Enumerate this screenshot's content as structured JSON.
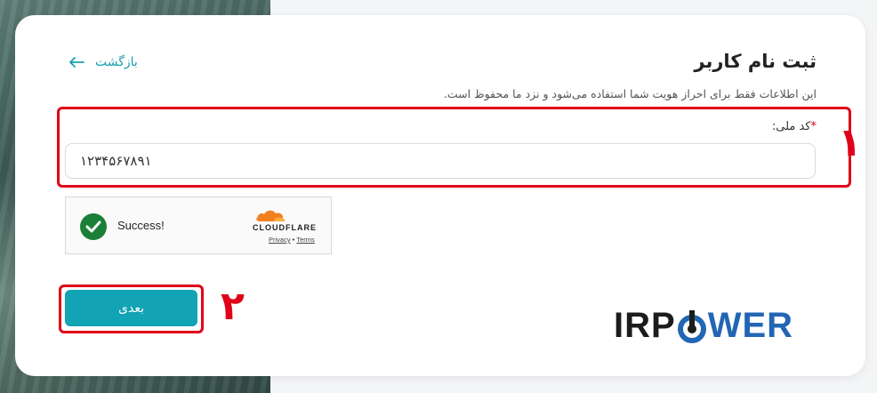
{
  "page": {
    "title": "ثبت نام کاربر",
    "back_label": "بازگشت",
    "subtitle": "این اطلاعات فقط برای احراز هویت شما استفاده می‌شود و نزد ما محفوظ است."
  },
  "form": {
    "national_code_label": "کد ملی:",
    "required_marker": "*",
    "national_code_value": "۱۲۳۴۵۶۷۸۹۱"
  },
  "captcha": {
    "status_text": "Success!",
    "provider": "CLOUDFLARE",
    "privacy_label": "Privacy",
    "separator": " • ",
    "terms_label": "Terms"
  },
  "actions": {
    "next_label": "بعدی"
  },
  "annotations": {
    "step_1": "۱",
    "step_2": "۲"
  },
  "brand": {
    "logo_ir": "IRP",
    "logo_rest": "WER"
  },
  "colors": {
    "accent": "#12a3b4",
    "annotation_red": "#e0001a",
    "success_green": "#1a7f37",
    "logo_blue": "#2266b4"
  },
  "icons": {
    "back": "arrow-left-icon",
    "captcha_success": "check-circle-icon",
    "cloudflare": "cloudflare-cloud-icon"
  }
}
